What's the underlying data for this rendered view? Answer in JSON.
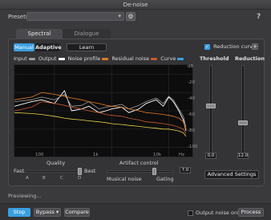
{
  "window": {
    "title": "De-noise"
  },
  "presets": {
    "label": "Presets",
    "value": ""
  },
  "tabs": [
    {
      "label": "Spectral"
    },
    {
      "label": "Dialogue"
    }
  ],
  "mode": {
    "manual": "Manual",
    "adaptive": "Adaptive",
    "learn": "Learn"
  },
  "reduction_curve": {
    "label": "Reduction curve",
    "checked": true,
    "plus": "+"
  },
  "legend": {
    "input": "Input",
    "output": "Output",
    "noise_profile": "Noise profile",
    "residual_noise": "Residual noise",
    "curve": "Curve",
    "colors": {
      "input": "#9a9a9a",
      "output": "#ffffff",
      "noise_profile": "#e07a22",
      "residual_noise": "#c85a2a",
      "curve": "#3aa0e0"
    }
  },
  "graph": {
    "x_ticks": [
      "100",
      "1k",
      "10k",
      "Hz"
    ],
    "y_ticks": [
      "-20",
      "-40",
      "-60",
      "-80",
      "-100"
    ],
    "y_top": "dB"
  },
  "chart_data": {
    "type": "line",
    "x_scale": "log",
    "x": [
      20,
      40,
      60,
      100,
      150,
      200,
      300,
      400,
      600,
      800,
      1000,
      1500,
      2000,
      3000,
      4000,
      6000,
      8000,
      10000,
      12000,
      15000,
      18000,
      20000
    ],
    "series": [
      {
        "name": "Output",
        "color": "#ffffff",
        "values": [
          -55,
          -50,
          -48,
          -52,
          -38,
          -60,
          -58,
          -55,
          -62,
          -60,
          -58,
          -56,
          -62,
          -58,
          -52,
          -48,
          -55,
          -45,
          -50,
          -60,
          -70,
          -82
        ]
      },
      {
        "name": "Input",
        "color": "#9a9a9a",
        "values": [
          -50,
          -48,
          -45,
          -48,
          -42,
          -55,
          -54,
          -50,
          -58,
          -56,
          -55,
          -53,
          -58,
          -54,
          -50,
          -46,
          -52,
          -44,
          -48,
          -58,
          -66,
          -78
        ]
      },
      {
        "name": "Noise profile",
        "color": "#e07a22",
        "values": [
          -48,
          -45,
          -40,
          -42,
          -44,
          -46,
          -48,
          -50,
          -52,
          -54,
          -55,
          -56,
          -58,
          -60,
          -62,
          -63,
          -64,
          -65,
          -66,
          -68,
          -72,
          -80
        ]
      },
      {
        "name": "Residual noise",
        "color": "#c85a2a",
        "values": [
          -60,
          -56,
          -50,
          -52,
          -54,
          -56,
          -58,
          -60,
          -62,
          -64,
          -65,
          -66,
          -68,
          -70,
          -72,
          -73,
          -74,
          -75,
          -76,
          -78,
          -80,
          -85
        ]
      },
      {
        "name": "Curve",
        "color": "#e6d24a",
        "values": [
          -62,
          -63,
          -64,
          -66,
          -68,
          -69,
          -70,
          -71,
          -72,
          -73,
          -74,
          -75,
          -76,
          -77,
          -78,
          -79,
          -80,
          -80,
          -81,
          -82,
          -84,
          -88
        ]
      }
    ],
    "ylim": [
      -110,
      -10
    ]
  },
  "threshold": {
    "label": "Threshold",
    "value": "0.0",
    "level": 0.55
  },
  "reduction": {
    "label": "Reduction",
    "value": "12.0",
    "level": 0.35
  },
  "advanced": {
    "label": "Advanced Settings"
  },
  "quality": {
    "label": "Quality",
    "fast": "Fast",
    "best": "Best",
    "ticks": [
      "A",
      "B",
      "C",
      "D"
    ],
    "level": 1.0
  },
  "artifact": {
    "label": "Artifact control",
    "value": "7.0",
    "left": "Musical noise",
    "right": "Gating",
    "level": 0.7
  },
  "status": {
    "text": "Previewing..."
  },
  "bottom": {
    "stop": "Stop",
    "bypass": "Bypass",
    "bypass_chevron": "▾",
    "compare": "Compare",
    "output_noise_only": "Output noise only",
    "process": "Process"
  }
}
